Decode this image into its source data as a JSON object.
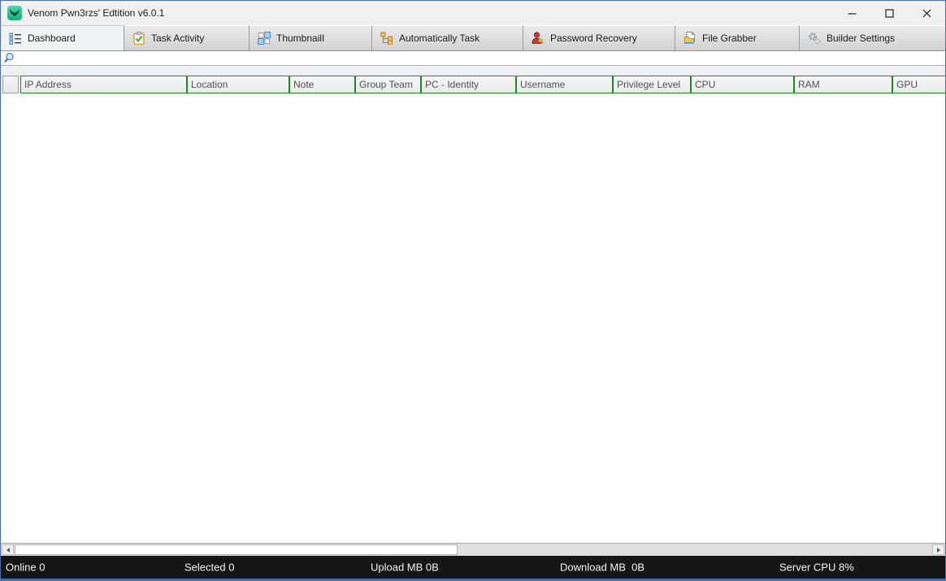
{
  "window": {
    "title": "Venom Pwn3rzs' Edtition v6.0.1",
    "app_icon": "venom-logo-icon",
    "controls": [
      {
        "name": "minimize"
      },
      {
        "name": "maximize"
      },
      {
        "name": "close"
      }
    ]
  },
  "tabs": [
    {
      "label": "Dashboard",
      "icon": "dashboard-list-icon",
      "selected": true
    },
    {
      "label": "Task Activity",
      "icon": "task-clipboard-icon",
      "selected": false
    },
    {
      "label": "ThumbnailI",
      "icon": "thumbnail-grid-icon",
      "selected": false
    },
    {
      "label": "Automatically Task",
      "icon": "hierarchy-icon",
      "selected": false
    },
    {
      "label": "Password Recovery",
      "icon": "user-key-icon",
      "selected": false
    },
    {
      "label": "File Grabber",
      "icon": "file-folder-icon",
      "selected": false
    },
    {
      "label": "Builder Settings",
      "icon": "gears-icon",
      "selected": false
    }
  ],
  "search": {
    "value": "",
    "icon": "search-magnifier-icon"
  },
  "table": {
    "columns": [
      "IP Address",
      "Location",
      "Note",
      "Group Team",
      "PC - Identity",
      "Username",
      "Privilege Level",
      "CPU",
      "RAM",
      "GPU"
    ],
    "rows": []
  },
  "scrollbar": {
    "left_arrow": "scroll-left-arrow-icon",
    "right_arrow": "scroll-right-arrow-icon"
  },
  "statusbar": {
    "items": [
      "Online 0",
      "Selected 0",
      "Upload MB 0B",
      "Download MB  0B",
      "Server CPU 8%"
    ]
  },
  "colors": {
    "window_border_blue": "#4a6da8",
    "header_border_green": "#1c8a1c",
    "statusbar_bg": "#161616",
    "statusbar_bottom_blue": "#4470b4",
    "tab_selected_bg": "#f1f2f4",
    "accent_blue": "#4a8fd4",
    "venom_green": "#14ad7c"
  }
}
